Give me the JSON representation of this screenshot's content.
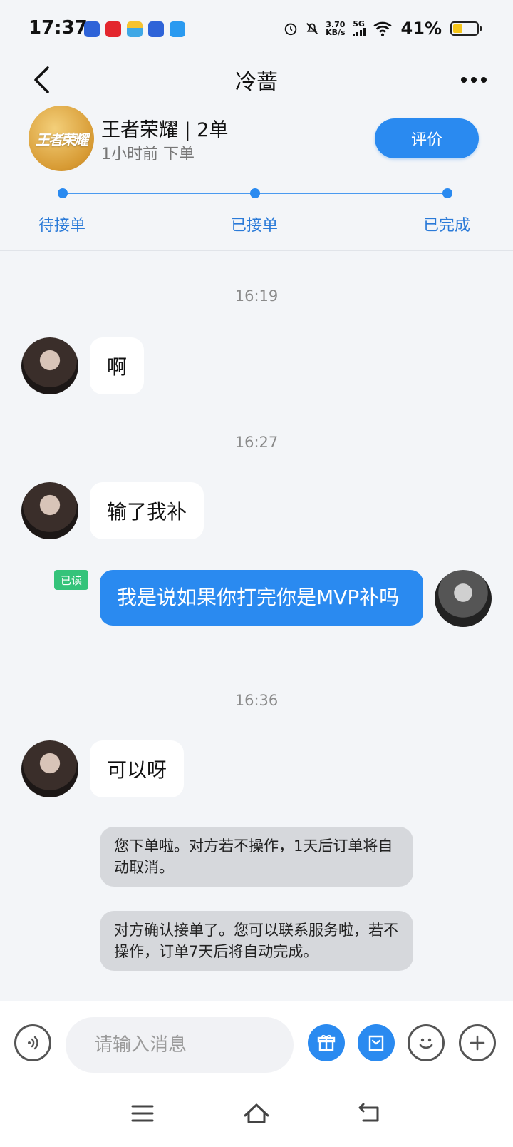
{
  "status_bar": {
    "time": "17:37",
    "net_speed_value": "3.70",
    "net_speed_unit": "KB/s",
    "network": "5G",
    "battery_percent": "41%",
    "battery_level": 0.41,
    "notification_icons": [
      "baidu-icon",
      "app-red-icon",
      "app-stripe-icon",
      "baidu-icon",
      "app-heart-icon"
    ]
  },
  "header": {
    "title": "冷蔷"
  },
  "order": {
    "logo_text": "王者荣耀",
    "title": "王者荣耀 | 2单",
    "subtitle": "1小时前  下单",
    "rate_button": "评价",
    "steps": [
      "待接单",
      "已接单",
      "已完成"
    ],
    "accent_color": "#2a8af0"
  },
  "messages": [
    {
      "type": "time",
      "text": "16:19"
    },
    {
      "type": "received",
      "text": "啊"
    },
    {
      "type": "time",
      "text": "16:27"
    },
    {
      "type": "received",
      "text": "输了我补"
    },
    {
      "type": "sent",
      "read_tag": "已读",
      "text": "我是说如果你打完你是MVP补吗"
    },
    {
      "type": "time",
      "text": "16:36"
    },
    {
      "type": "received",
      "text": "可以呀"
    },
    {
      "type": "system",
      "text": "您下单啦。对方若不操作，1天后订单将自动取消。"
    },
    {
      "type": "system",
      "text": "对方确认接单了。您可以联系服务啦，若不操作，订单7天后将自动完成。"
    }
  ],
  "input_bar": {
    "placeholder": "请输入消息"
  }
}
